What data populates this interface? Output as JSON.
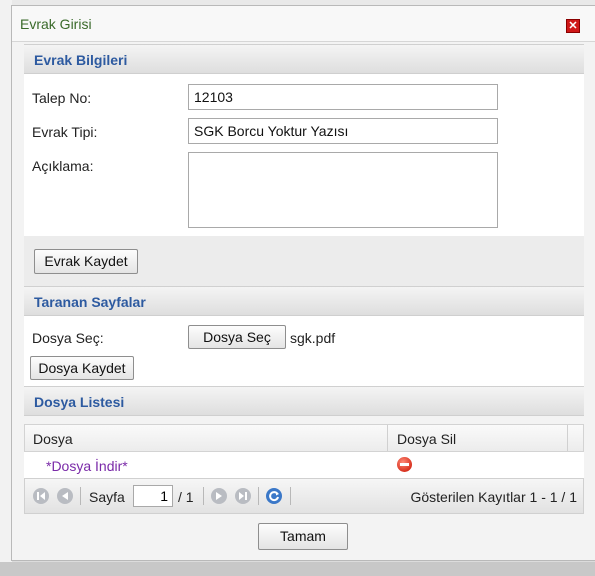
{
  "dialog": {
    "title": "Evrak Girisi",
    "close_icon": "close-icon"
  },
  "evrak_bilgileri": {
    "header": "Evrak Bilgileri",
    "talep_no_label": "Talep No:",
    "talep_no_value": "12103",
    "evrak_tipi_label": "Evrak Tipi:",
    "evrak_tipi_value": "SGK Borcu Yoktur Yazısı",
    "aciklama_label": "Açıklama:",
    "aciklama_value": "",
    "save_button": "Evrak Kaydet"
  },
  "taranan_sayfalar": {
    "header": "Taranan Sayfalar",
    "dosya_sec_label": "Dosya Seç:",
    "file_button": "Dosya Seç",
    "file_name": "sgk.pdf",
    "save_button": "Dosya Kaydet"
  },
  "dosya_listesi": {
    "header": "Dosya Listesi",
    "columns": [
      "Dosya",
      "Dosya Sil"
    ],
    "rows": [
      {
        "dosya": "*Dosya İndir*",
        "sil_icon": "delete-icon"
      }
    ]
  },
  "pager": {
    "page_label": "Sayfa",
    "page_value": "1",
    "page_total": "/ 1",
    "records_text": "Gösterilen Kayıtlar 1 - 1 / 1",
    "icons": [
      "first-page-icon",
      "prev-page-icon",
      "next-page-icon",
      "last-page-icon",
      "refresh-icon"
    ]
  },
  "footer": {
    "ok_button": "Tamam"
  },
  "colors": {
    "section_header_text": "#2d5aa0",
    "title_text": "#3a6a2a",
    "link": "#7a2aa8",
    "close": "#d01818"
  }
}
